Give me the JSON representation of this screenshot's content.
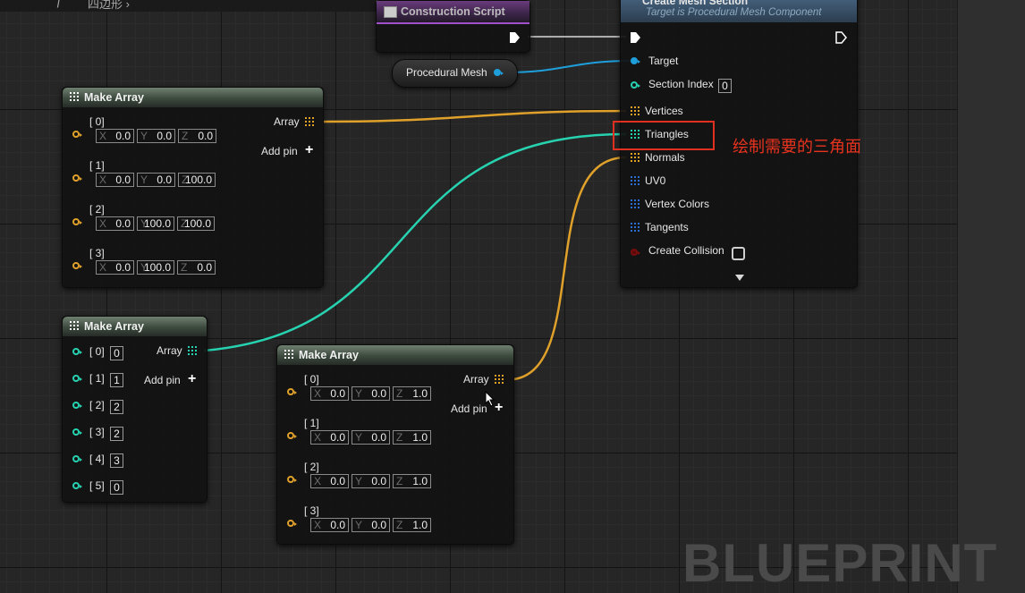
{
  "topbar": {
    "breadcrumb_symbol": "ƒ",
    "breadcrumb_text": "四边形 ›"
  },
  "construction_script": {
    "title": "Construction Script"
  },
  "procedural_mesh": {
    "label": "Procedural Mesh"
  },
  "create_mesh_node": {
    "title": "Create Mesh Section",
    "subtitle": "Target is Procedural Mesh Component",
    "pins": {
      "target": "Target",
      "section_index": "Section Index",
      "section_index_value": "0",
      "vertices": "Vertices",
      "triangles": "Triangles",
      "normals": "Normals",
      "uv0": "UV0",
      "vertex_colors": "Vertex Colors",
      "tangents": "Tangents",
      "create_collision": "Create Collision"
    }
  },
  "annotation": {
    "text": "绘制需要的三角面"
  },
  "make_array_vertices": {
    "title": "Make Array",
    "output_label": "Array",
    "add_pin_label": "Add pin",
    "items": [
      {
        "label": "[ 0]",
        "x": "0.0",
        "y": "0.0",
        "z": "0.0"
      },
      {
        "label": "[ 1]",
        "x": "0.0",
        "y": "0.0",
        "z": "100.0"
      },
      {
        "label": "[ 2]",
        "x": "0.0",
        "y": "100.0",
        "z": "100.0"
      },
      {
        "label": "[ 3]",
        "x": "0.0",
        "y": "100.0",
        "z": "0.0"
      }
    ]
  },
  "make_array_triangles": {
    "title": "Make Array",
    "output_label": "Array",
    "add_pin_label": "Add pin",
    "items": [
      {
        "label": "[ 0]",
        "value": "0"
      },
      {
        "label": "[ 1]",
        "value": "1"
      },
      {
        "label": "[ 2]",
        "value": "2"
      },
      {
        "label": "[ 3]",
        "value": "2"
      },
      {
        "label": "[ 4]",
        "value": "3"
      },
      {
        "label": "[ 5]",
        "value": "0"
      }
    ]
  },
  "make_array_normals": {
    "title": "Make Array",
    "output_label": "Array",
    "add_pin_label": "Add pin",
    "items": [
      {
        "label": "[ 0]",
        "x": "0.0",
        "y": "0.0",
        "z": "1.0"
      },
      {
        "label": "[ 1]",
        "x": "0.0",
        "y": "0.0",
        "z": "1.0"
      },
      {
        "label": "[ 2]",
        "x": "0.0",
        "y": "0.0",
        "z": "1.0"
      },
      {
        "label": "[ 3]",
        "x": "0.0",
        "y": "0.0",
        "z": "1.0"
      }
    ]
  },
  "axis_labels": {
    "x": "X",
    "y": "Y",
    "z": "Z"
  },
  "watermark": "BLUEPRINT",
  "colors": {
    "vector_pin": "#e0a12a",
    "int_pin": "#27d2b0",
    "object_pin": "#1e9fdb",
    "highlight": "#e03020"
  }
}
